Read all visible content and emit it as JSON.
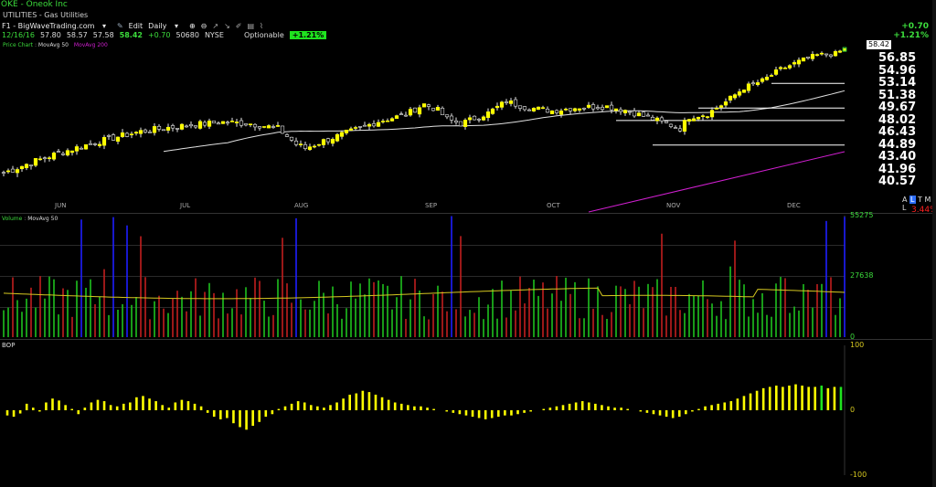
{
  "header": {
    "title": "OKE - Oneok Inc",
    "subtitle": "UTILITIES - Gas Utilities"
  },
  "toolbar": {
    "source": "F1 - BigWaveTrading.com",
    "source_arrow": "▾",
    "edit_label": "Edit",
    "period_label": "Daily",
    "period_arrow": "▾"
  },
  "quote": {
    "date": "12/16/16",
    "open": "57.80",
    "high": "58.57",
    "low": "57.58",
    "close": "58.42",
    "change": "+0.70",
    "volume": "50680",
    "exchange": "NYSE",
    "optionable_label": "Optionable",
    "pct_badge": "+1.21%"
  },
  "top_right": {
    "change": "+0.70",
    "pct": "+1.21%",
    "last_price": "58.42"
  },
  "legend": {
    "price_chart": "Price Chart",
    "ma50": "MovAvg 50",
    "ma200": "MovAvg 200",
    "volume": "Volume",
    "vol_ma": "MovAvg 50",
    "bop": "BOP"
  },
  "atml": {
    "a": "A",
    "l": "L",
    "t": "T",
    "m": "M",
    "l2": "L",
    "pct": "3.44%"
  },
  "colors": {
    "candle_up": "#ffff00",
    "candle_down": "#000000",
    "ma50": "#e0e0e0",
    "ma200": "#d01fd0",
    "vol_up": "#1fc21f",
    "vol_down": "#c21f1f",
    "vol_spike": "#1f1fff",
    "bop_bar": "#ffff00",
    "green_text": "#3cdc3c"
  },
  "chart_data": [
    {
      "type": "candlestick",
      "title": "OKE - Oneok Inc",
      "x_labels": [
        "JUN",
        "JUL",
        "AUG",
        "SEP",
        "OCT",
        "NOV",
        "DEC"
      ],
      "y_ticks": [
        56.85,
        54.96,
        53.14,
        51.38,
        49.67,
        48.02,
        46.43,
        44.89,
        43.4,
        41.96,
        40.57
      ],
      "ylim": [
        40.0,
        59.2
      ],
      "scale": "log",
      "last": 58.42,
      "close_path": [
        [
          0,
          41.6
        ],
        [
          6,
          42.8
        ],
        [
          12,
          43.9
        ],
        [
          18,
          44.9
        ],
        [
          24,
          45.8
        ],
        [
          30,
          46.6
        ],
        [
          36,
          47.1
        ],
        [
          42,
          47.5
        ],
        [
          48,
          47.8
        ],
        [
          54,
          47.6
        ],
        [
          60,
          47.0
        ],
        [
          64,
          45.0
        ],
        [
          66,
          44.5
        ],
        [
          70,
          45.4
        ],
        [
          76,
          46.6
        ],
        [
          82,
          47.9
        ],
        [
          88,
          48.8
        ],
        [
          92,
          50.2
        ],
        [
          95,
          49.4
        ],
        [
          97,
          48.2
        ],
        [
          100,
          47.6
        ],
        [
          106,
          49.0
        ],
        [
          110,
          50.6
        ],
        [
          114,
          49.8
        ],
        [
          120,
          49.3
        ],
        [
          126,
          49.8
        ],
        [
          132,
          49.9
        ],
        [
          136,
          49.4
        ],
        [
          140,
          48.6
        ],
        [
          144,
          47.8
        ],
        [
          148,
          47.0
        ],
        [
          150,
          48.5
        ],
        [
          154,
          48.9
        ],
        [
          158,
          50.5
        ],
        [
          162,
          52.5
        ],
        [
          166,
          53.5
        ],
        [
          170,
          55.2
        ],
        [
          174,
          56.4
        ],
        [
          178,
          57.4
        ],
        [
          182,
          57.6
        ],
        [
          184,
          58.42
        ]
      ],
      "candles_count": 185,
      "ma50_range": [
        35,
        184
      ],
      "ma200_range": [
        128,
        184
      ],
      "support_lines": [
        {
          "price": 53.14,
          "from": 168,
          "to": 184
        },
        {
          "price": 49.67,
          "from": 152,
          "to": 184
        },
        {
          "price": 48.02,
          "from": 134,
          "to": 184
        },
        {
          "price": 44.89,
          "from": 142,
          "to": 184
        }
      ]
    },
    {
      "type": "bar",
      "title": "Volume",
      "y_ticks": [
        55275,
        27638,
        0
      ],
      "ylim": [
        0,
        55275
      ],
      "spike_indices": [
        17,
        24,
        27,
        64,
        98,
        180,
        184
      ],
      "red_tall_indices": [
        22,
        30,
        61,
        100,
        144,
        160
      ],
      "green_tall_indices": [
        159,
        170,
        175
      ]
    },
    {
      "type": "bar",
      "title": "BOP",
      "y_ticks": [
        100,
        0,
        -100
      ],
      "ylim": [
        -100,
        100
      ],
      "values": [
        -8,
        -10,
        -5,
        10,
        4,
        -2,
        12,
        18,
        15,
        8,
        2,
        -6,
        4,
        12,
        16,
        14,
        8,
        6,
        10,
        12,
        20,
        22,
        18,
        14,
        8,
        4,
        12,
        16,
        14,
        10,
        6,
        -4,
        -10,
        -14,
        -12,
        -20,
        -26,
        -30,
        -24,
        -18,
        -10,
        -6,
        2,
        6,
        10,
        14,
        12,
        8,
        6,
        4,
        8,
        12,
        18,
        24,
        26,
        30,
        28,
        24,
        20,
        16,
        12,
        10,
        8,
        6,
        6,
        4,
        2,
        0,
        -2,
        -4,
        -6,
        -8,
        -10,
        -12,
        -14,
        -12,
        -10,
        -8,
        -8,
        -6,
        -4,
        -2,
        0,
        2,
        4,
        6,
        8,
        10,
        12,
        14,
        12,
        10,
        8,
        6,
        4,
        4,
        2,
        0,
        -2,
        -4,
        -6,
        -8,
        -10,
        -12,
        -10,
        -6,
        -2,
        2,
        6,
        8,
        10,
        12,
        14,
        18,
        22,
        26,
        30,
        34,
        36,
        38,
        36,
        38,
        40,
        38,
        36,
        36,
        38,
        34,
        36,
        36
      ],
      "last_green_indices": [
        126,
        129
      ]
    }
  ]
}
